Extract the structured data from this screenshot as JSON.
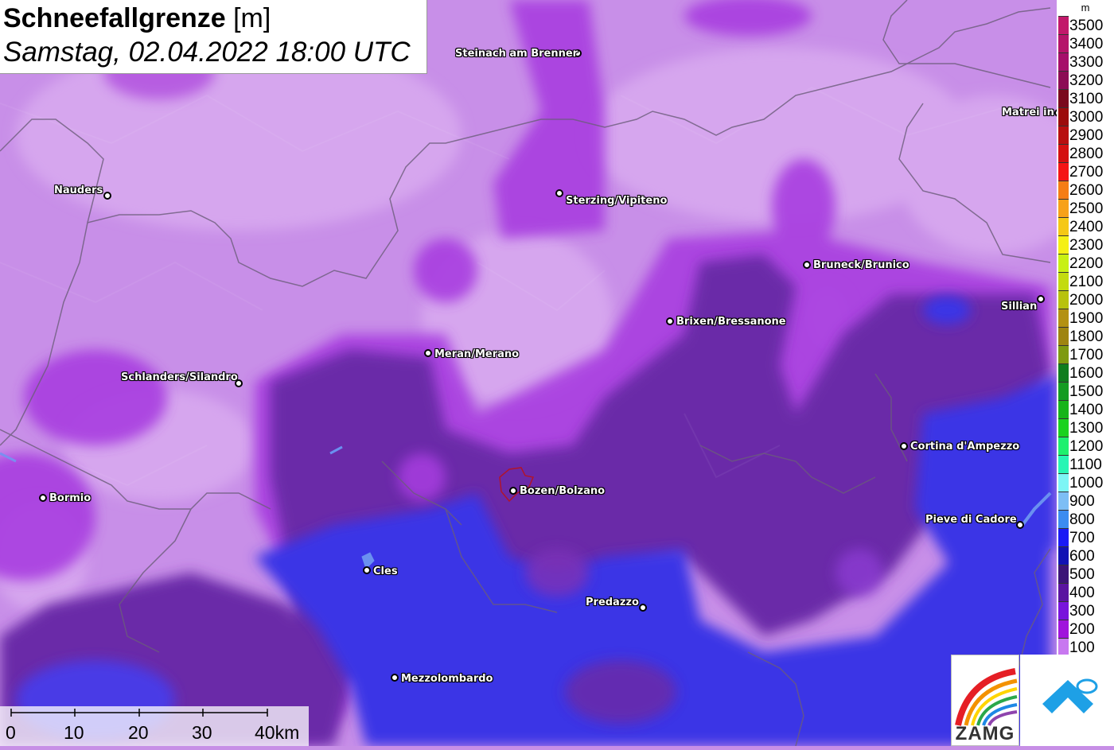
{
  "title": {
    "main_bold": "Schneefallgrenze",
    "main_unit": "[m]",
    "datetime": "Samstag, 02.04.2022 18:00 UTC"
  },
  "legend": {
    "unit": "m",
    "items": [
      {
        "label": "3500",
        "color": "#c2196b"
      },
      {
        "label": "3400",
        "color": "#b5146a"
      },
      {
        "label": "3300",
        "color": "#a60f6a"
      },
      {
        "label": "3200",
        "color": "#8c0d55"
      },
      {
        "label": "3100",
        "color": "#7a0a1e"
      },
      {
        "label": "3000",
        "color": "#9c0c0c"
      },
      {
        "label": "2900",
        "color": "#b80f0f"
      },
      {
        "label": "2800",
        "color": "#d41111"
      },
      {
        "label": "2700",
        "color": "#f51616"
      },
      {
        "label": "2600",
        "color": "#f57d14"
      },
      {
        "label": "2500",
        "color": "#f7a11a"
      },
      {
        "label": "2400",
        "color": "#f5c816"
      },
      {
        "label": "2300",
        "color": "#f5f016"
      },
      {
        "label": "2200",
        "color": "#c8f014"
      },
      {
        "label": "2100",
        "color": "#c3db10"
      },
      {
        "label": "2000",
        "color": "#b8c20e"
      },
      {
        "label": "1900",
        "color": "#b39112"
      },
      {
        "label": "1800",
        "color": "#9e8410"
      },
      {
        "label": "1700",
        "color": "#7e9a10"
      },
      {
        "label": "1600",
        "color": "#0f7d1e"
      },
      {
        "label": "1500",
        "color": "#149c22"
      },
      {
        "label": "1400",
        "color": "#17b41a"
      },
      {
        "label": "1300",
        "color": "#1ad21e"
      },
      {
        "label": "1200",
        "color": "#1ef06e"
      },
      {
        "label": "1100",
        "color": "#28f5b4"
      },
      {
        "label": "1000",
        "color": "#7df5f5"
      },
      {
        "label": "900",
        "color": "#7dbef5"
      },
      {
        "label": "800",
        "color": "#3c8cf0"
      },
      {
        "label": "700",
        "color": "#1a1af5"
      },
      {
        "label": "600",
        "color": "#1212b4"
      },
      {
        "label": "500",
        "color": "#3c1478"
      },
      {
        "label": "400",
        "color": "#5a14a0"
      },
      {
        "label": "300",
        "color": "#7814dc"
      },
      {
        "label": "200",
        "color": "#a014dc"
      },
      {
        "label": "100",
        "color": "#c878f0"
      }
    ]
  },
  "cities": [
    {
      "name": "Steinach am Brenner"
    },
    {
      "name": "Matrei in Osttirol"
    },
    {
      "name": "Nauders"
    },
    {
      "name": "Sterzing/Vipiteno"
    },
    {
      "name": "Bruneck/Brunico"
    },
    {
      "name": "Sillian"
    },
    {
      "name": "Brixen/Bressanone"
    },
    {
      "name": "Meran/Merano"
    },
    {
      "name": "Schlanders/Silandro"
    },
    {
      "name": "Cortina d'Ampezzo"
    },
    {
      "name": "Bormio"
    },
    {
      "name": "Bozen/Bolzano"
    },
    {
      "name": "Pieve di Cadore"
    },
    {
      "name": "Cles"
    },
    {
      "name": "Predazzo"
    },
    {
      "name": "Mezzolombardo"
    }
  ],
  "scale": {
    "labels": [
      "0",
      "10",
      "20",
      "30",
      "40km"
    ]
  },
  "logos": {
    "zamg_text": "ZAMG"
  }
}
